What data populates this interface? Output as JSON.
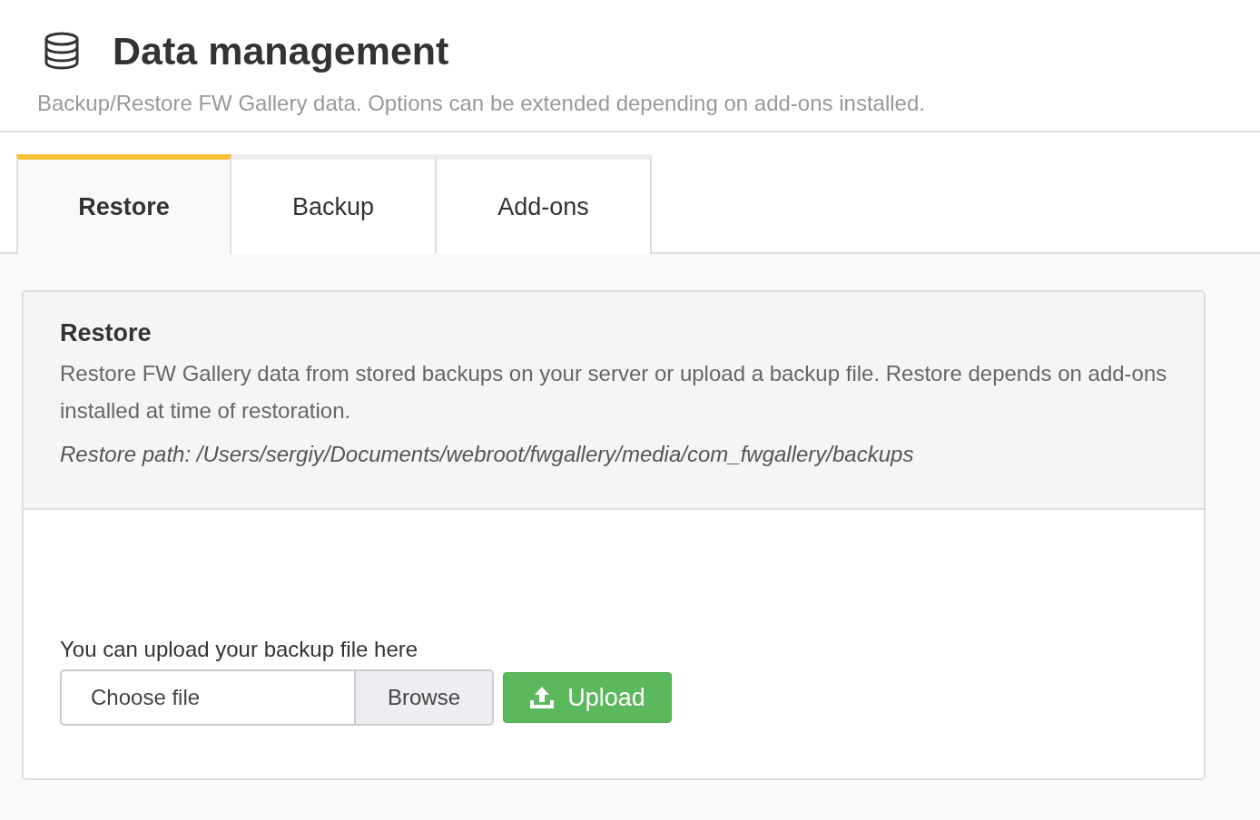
{
  "header": {
    "title": "Data management",
    "subtitle": "Backup/Restore FW Gallery data. Options can be extended depending on add-ons installed."
  },
  "tabs": [
    {
      "label": "Restore",
      "selected": true
    },
    {
      "label": "Backup",
      "selected": false
    },
    {
      "label": "Add-ons",
      "selected": false
    }
  ],
  "panel": {
    "title": "Restore",
    "description": "Restore FW Gallery data from stored backups on your server or upload a backup file. Restore depends on add-ons installed at time of restoration.",
    "path": "Restore path: /Users/sergiy/Documents/webroot/fwgallery/media/com_fwgallery/backups"
  },
  "upload": {
    "label": "You can upload your backup file here",
    "file_field": {
      "placeholder": "Choose file"
    },
    "browse_button": "Browse",
    "upload_button": "Upload"
  }
}
